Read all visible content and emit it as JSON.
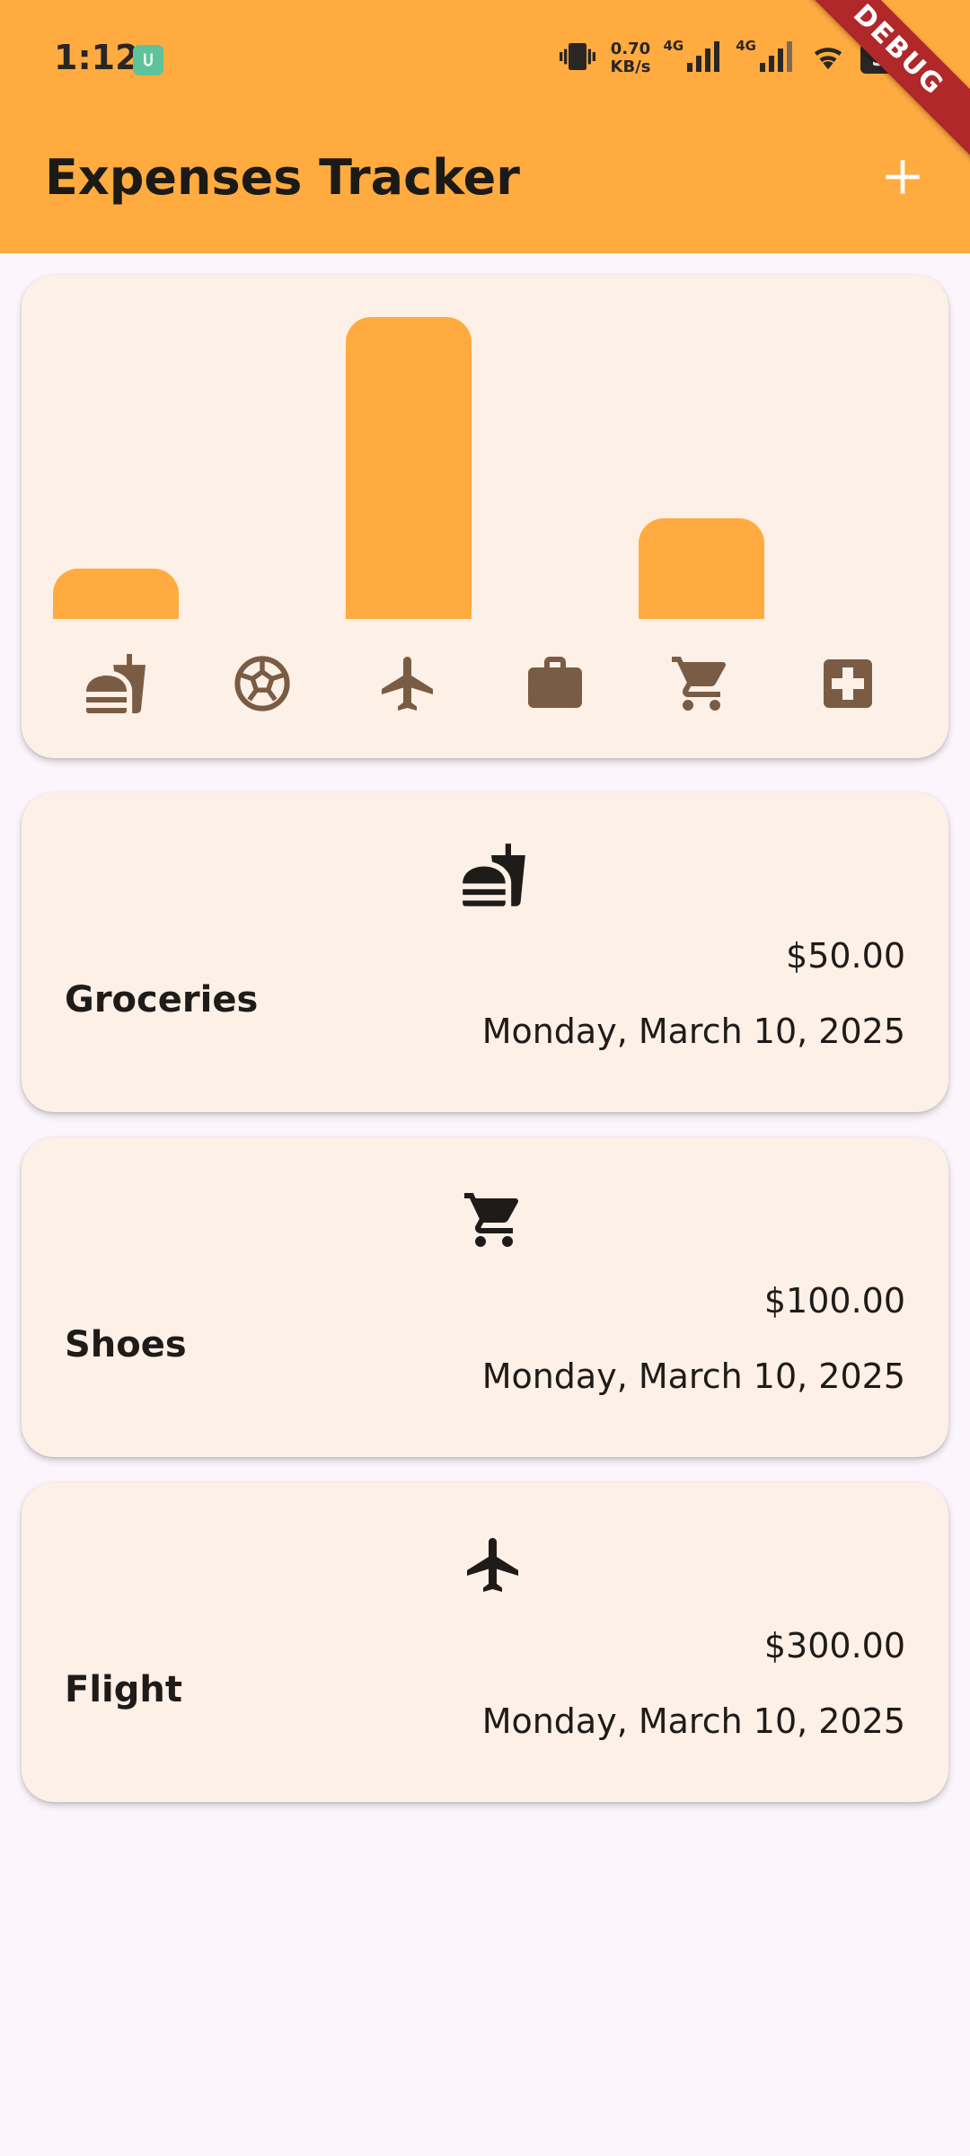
{
  "status_bar": {
    "time": "1:12",
    "net_speed_value": "0.70",
    "net_speed_unit": "KB/s",
    "signal_label_1": "4G",
    "signal_label_2": "4G",
    "battery": "50"
  },
  "debug_banner": "DEBUG",
  "app_bar": {
    "title": "Expenses Tracker",
    "add_icon": "plus-icon"
  },
  "colors": {
    "app_bar": "#ffab40",
    "bar": "#ffab40",
    "card": "#fdf0e6",
    "chart_icon": "#7a5c44",
    "background": "#fcf6fc"
  },
  "chart_data": {
    "type": "bar",
    "categories": [
      "food",
      "leisure",
      "travel",
      "work",
      "shopping",
      "health"
    ],
    "category_icons": [
      "fastfood-icon",
      "soccer-ball-icon",
      "airplane-icon",
      "briefcase-icon",
      "shopping-cart-icon",
      "medical-cross-icon"
    ],
    "values": [
      50,
      0,
      300,
      0,
      100,
      0
    ],
    "ylim": [
      0,
      300
    ],
    "title": "",
    "xlabel": "",
    "ylabel": ""
  },
  "expenses": [
    {
      "title": "Groceries",
      "amount": "$50.00",
      "date": "Monday, March 10, 2025",
      "icon": "fastfood-icon"
    },
    {
      "title": "Shoes",
      "amount": "$100.00",
      "date": "Monday, March 10, 2025",
      "icon": "shopping-cart-icon"
    },
    {
      "title": "Flight",
      "amount": "$300.00",
      "date": "Monday, March 10, 2025",
      "icon": "airplane-icon"
    }
  ]
}
